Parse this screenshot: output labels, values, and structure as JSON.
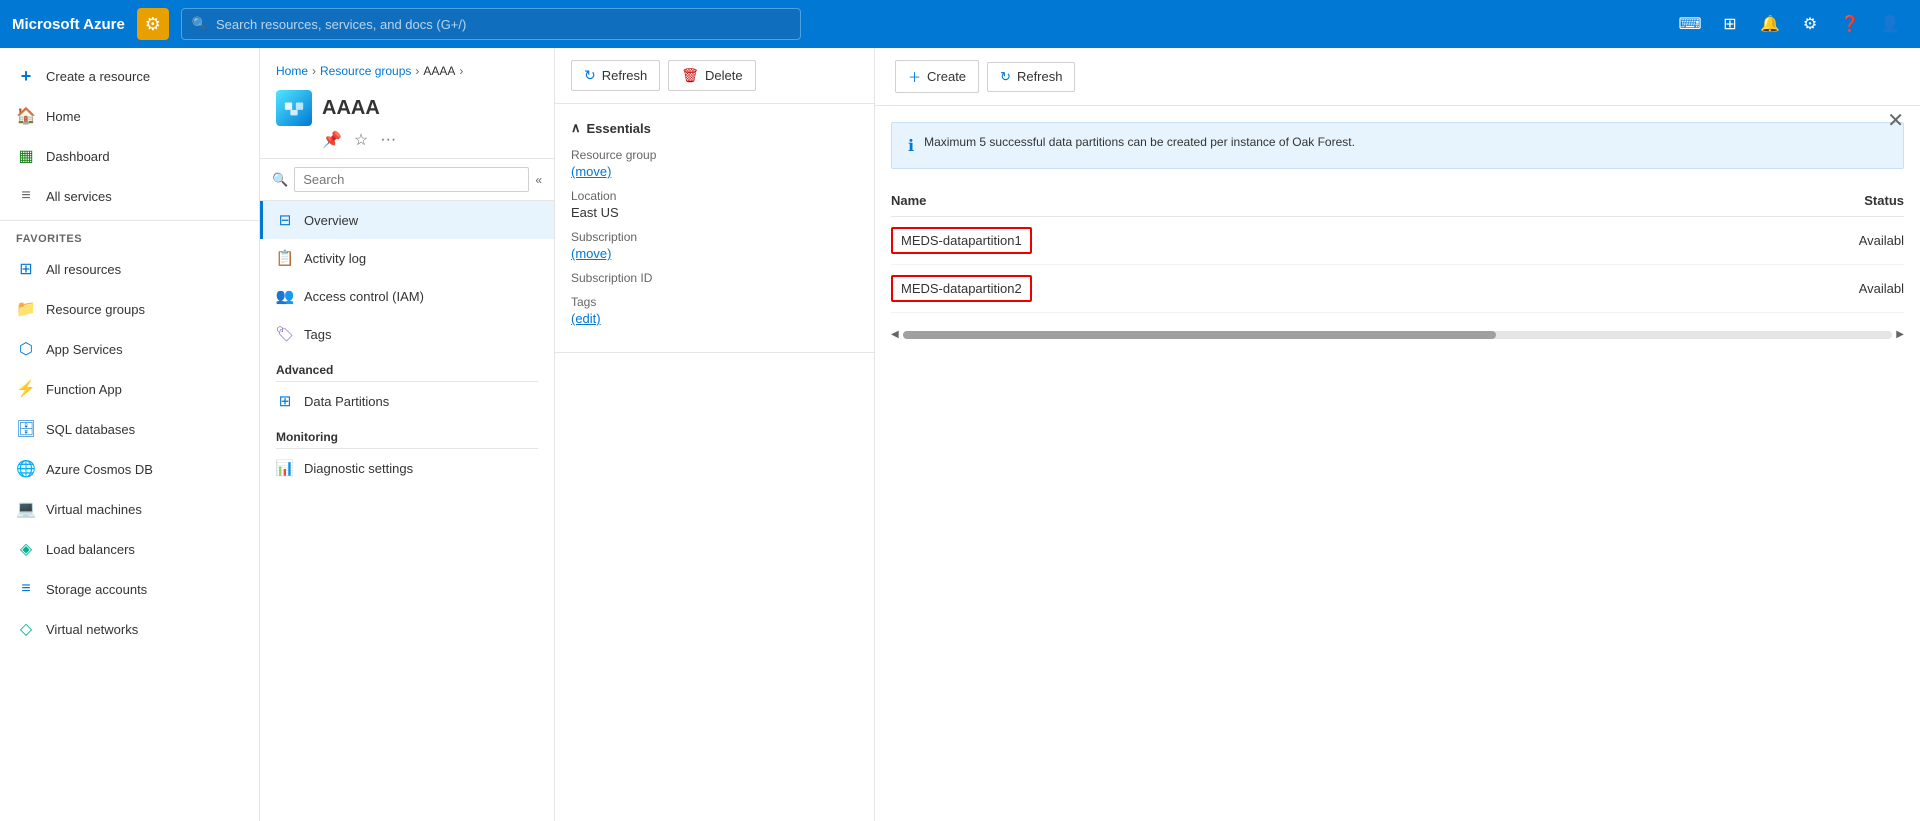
{
  "topbar": {
    "brand": "Microsoft Azure",
    "search_placeholder": "Search resources, services, and docs (G+/)",
    "icons": [
      "terminal-icon",
      "portal-icon",
      "bell-icon",
      "settings-icon",
      "help-icon",
      "user-icon"
    ]
  },
  "sidebar": {
    "create_label": "Create a resource",
    "home_label": "Home",
    "dashboard_label": "Dashboard",
    "all_services_label": "All services",
    "favorites_label": "FAVORITES",
    "items": [
      {
        "label": "All resources",
        "icon": "grid"
      },
      {
        "label": "Resource groups",
        "icon": "folder"
      },
      {
        "label": "App Services",
        "icon": "app"
      },
      {
        "label": "Function App",
        "icon": "function"
      },
      {
        "label": "SQL databases",
        "icon": "sql"
      },
      {
        "label": "Azure Cosmos DB",
        "icon": "cosmos"
      },
      {
        "label": "Virtual machines",
        "icon": "vm"
      },
      {
        "label": "Load balancers",
        "icon": "lb"
      },
      {
        "label": "Storage accounts",
        "icon": "storage"
      },
      {
        "label": "Virtual networks",
        "icon": "vnet"
      }
    ]
  },
  "breadcrumb": {
    "home": "Home",
    "resource_groups": "Resource groups",
    "current": "AAAA"
  },
  "resource": {
    "name": "AAAA"
  },
  "left_panel": {
    "search_placeholder": "Search",
    "nav_items": [
      {
        "label": "Overview",
        "active": true
      },
      {
        "label": "Activity log"
      },
      {
        "label": "Access control (IAM)"
      },
      {
        "label": "Tags"
      }
    ],
    "section_advanced": "Advanced",
    "advanced_items": [
      {
        "label": "Data Partitions"
      }
    ],
    "section_monitoring": "Monitoring",
    "monitoring_items": [
      {
        "label": "Diagnostic settings"
      }
    ]
  },
  "middle_panel": {
    "refresh_label": "Refresh",
    "delete_label": "Delete",
    "essentials_title": "Essentials",
    "fields": [
      {
        "label": "Resource group",
        "value": "",
        "link": "move",
        "has_link": true
      },
      {
        "label": "Location",
        "value": "East US",
        "has_link": false
      },
      {
        "label": "Subscription",
        "value": "",
        "link": "move",
        "has_link": true
      },
      {
        "label": "Subscription ID",
        "value": "",
        "has_link": false
      },
      {
        "label": "Tags",
        "value": "",
        "link": "edit",
        "has_link": true
      }
    ]
  },
  "right_panel": {
    "create_label": "Create",
    "refresh_label": "Refresh",
    "info_message": "Maximum 5 successful data partitions can be created per instance of Oak Forest.",
    "table": {
      "col_name": "Name",
      "col_status": "Status",
      "rows": [
        {
          "name": "MEDS-datapartition1",
          "status": "Availabl"
        },
        {
          "name": "MEDS-datapartition2",
          "status": "Availabl"
        }
      ]
    }
  }
}
